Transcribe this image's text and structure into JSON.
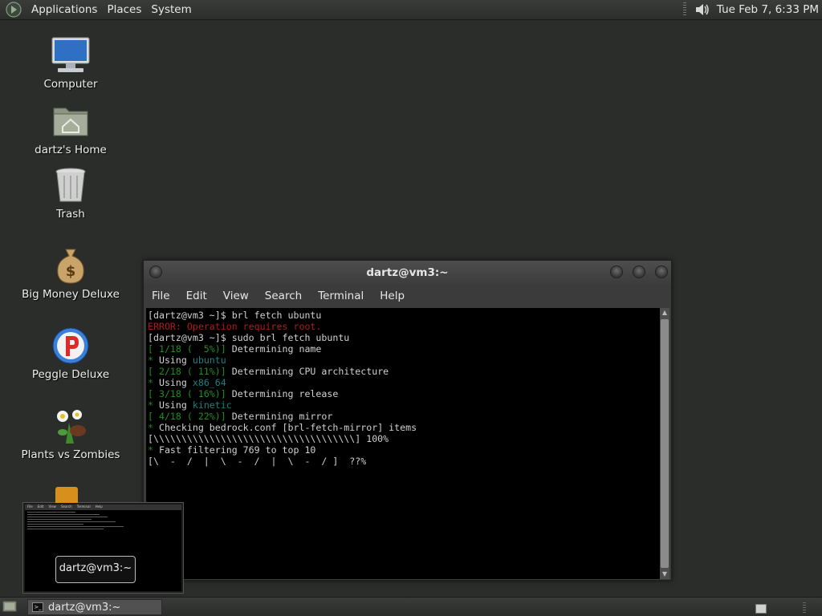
{
  "top_panel": {
    "menus": [
      "Applications",
      "Places",
      "System"
    ],
    "clock": "Tue Feb  7, 6:33 PM"
  },
  "desktop_icons": [
    {
      "label": "Computer",
      "icon": "computer-icon"
    },
    {
      "label": "dartz's Home",
      "icon": "home-folder-icon"
    },
    {
      "label": "Trash",
      "icon": "trash-icon"
    },
    {
      "label": "Big Money Deluxe",
      "icon": "money-bag-icon"
    },
    {
      "label": "Peggle Deluxe",
      "icon": "peggle-icon"
    },
    {
      "label": "Plants vs Zombies",
      "icon": "plants-icon"
    }
  ],
  "terminal": {
    "title": "dartz@vm3:~",
    "menus": [
      "File",
      "Edit",
      "View",
      "Search",
      "Terminal",
      "Help"
    ],
    "lines": [
      [
        {
          "t": "[dartz@vm3 ~]$ brl fetch ubuntu",
          "c": ""
        }
      ],
      [
        {
          "t": "ERROR: Operation requires root.",
          "c": "red"
        }
      ],
      [
        {
          "t": "[dartz@vm3 ~]$ sudo brl fetch ubuntu",
          "c": ""
        }
      ],
      [
        {
          "t": "[ 1/18 (  5%)]",
          "c": "green"
        },
        {
          "t": " Determining name",
          "c": ""
        }
      ],
      [
        {
          "t": "* ",
          "c": "green"
        },
        {
          "t": "Using ",
          "c": ""
        },
        {
          "t": "ubuntu",
          "c": "teal"
        }
      ],
      [
        {
          "t": "[ 2/18 ( 11%)]",
          "c": "green"
        },
        {
          "t": " Determining CPU architecture",
          "c": ""
        }
      ],
      [
        {
          "t": "* ",
          "c": "green"
        },
        {
          "t": "Using ",
          "c": ""
        },
        {
          "t": "x86_64",
          "c": "teal"
        }
      ],
      [
        {
          "t": "[ 3/18 ( 16%)]",
          "c": "green"
        },
        {
          "t": " Determining release",
          "c": ""
        }
      ],
      [
        {
          "t": "* ",
          "c": "green"
        },
        {
          "t": "Using ",
          "c": ""
        },
        {
          "t": "kinetic",
          "c": "teal"
        }
      ],
      [
        {
          "t": "[ 4/18 ( 22%)]",
          "c": "green"
        },
        {
          "t": " Determining mirror",
          "c": ""
        }
      ],
      [
        {
          "t": "* ",
          "c": "green"
        },
        {
          "t": "Checking bedrock.conf [brl-fetch-mirror] items",
          "c": ""
        }
      ],
      [
        {
          "t": "[\\\\\\\\\\\\\\\\\\\\\\\\\\\\\\\\\\\\\\\\\\\\\\\\\\\\\\\\\\\\\\\\\\\\\\\\] 100%",
          "c": ""
        }
      ],
      [
        {
          "t": "* ",
          "c": "green"
        },
        {
          "t": "Fast filtering 769 to top 10",
          "c": ""
        }
      ],
      [
        {
          "t": "[\\  -  /  |  \\  -  /  |  \\  -  / ]  ??%",
          "c": ""
        }
      ]
    ]
  },
  "preview": {
    "label": "dartz@vm3:~",
    "menus": [
      "File",
      "Edit",
      "View",
      "Search",
      "Terminal",
      "Help"
    ]
  },
  "taskbar": {
    "task_label": "dartz@vm3:~"
  },
  "colors": {
    "error": "#b11a1a",
    "progress": "#1e8f1e",
    "value": "#1f7f80"
  }
}
